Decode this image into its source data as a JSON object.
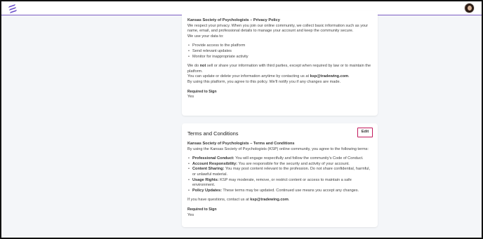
{
  "topbar": {
    "logo_icon": "lightning-stripes-logo",
    "avatar_icon": "user-avatar"
  },
  "privacy": {
    "heading": "Kansas Society of Psychologists – Privacy Policy",
    "intro": "We respect your privacy. When you join our online community, we collect basic information such as your name, email, and professional details to manage your account and keep the community secure.",
    "use_line": "We use your data to:",
    "uses": [
      "Provide access to the platform",
      "Send relevant updates",
      "Monitor for inappropriate activity"
    ],
    "share_pre": "We do ",
    "share_bold": "not",
    "share_post": " sell or share your information with third parties, except when required by law or to maintain the platform.",
    "update_pre": "You can update or delete your information anytime by contacting us at ",
    "update_email": "ksp@tradewing.com",
    "update_post": ".",
    "agree_line": "By using this platform, you agree to this policy. We'll notify you if any changes are made.",
    "required_label": "Required to Sign",
    "required_value": "Yes"
  },
  "terms": {
    "title": "Terms and Conditions",
    "edit_label": "Edit",
    "heading": "Kansas Society of Psychologists – Terms and Conditions",
    "intro": "By using the Kansas Society of Psychologists (KSP) online community, you agree to the following terms:",
    "items": [
      {
        "label": "Professional Conduct:",
        "text": " You will engage respectfully and follow the community's Code of Conduct."
      },
      {
        "label": "Account Responsibility:",
        "text": " You are responsible for the security and activity of your account."
      },
      {
        "label": "Content Sharing:",
        "text": " You may post content relevant to the profession. Do not share confidential, harmful, or unlawful material."
      },
      {
        "label": "Usage Rights:",
        "text": " KSP may moderate, remove, or restrict content or access to maintain a safe environment."
      },
      {
        "label": "Policy Updates:",
        "text": " These terms may be updated. Continued use means you accept any changes."
      }
    ],
    "contact_pre": "If you have questions, contact us at ",
    "contact_email": "ksp@tradewing.com",
    "contact_post": ".",
    "required_label": "Required to Sign",
    "required_value": "Yes"
  }
}
